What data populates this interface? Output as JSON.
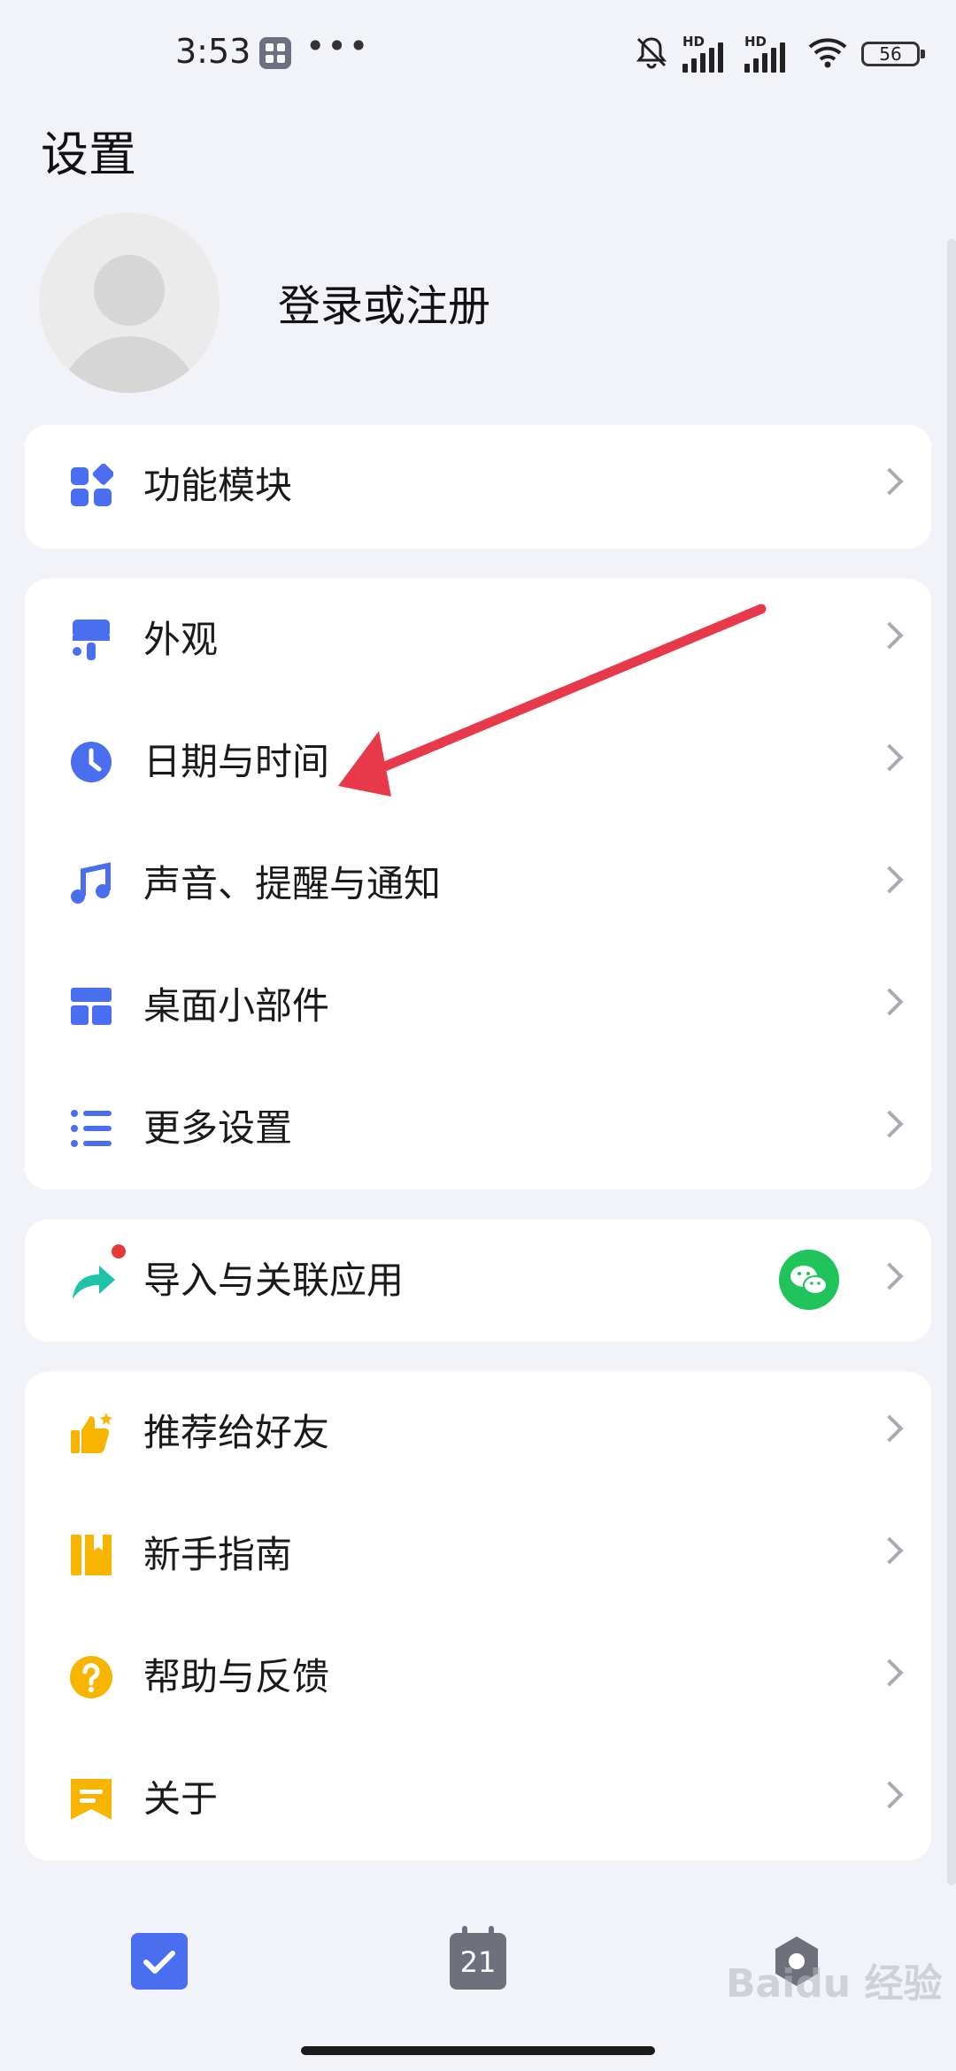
{
  "status_bar": {
    "time": "3:53",
    "dots": "•••",
    "signal_label": "HD",
    "battery": "56"
  },
  "page": {
    "title": "设置"
  },
  "profile": {
    "login_label": "登录或注册"
  },
  "groups": [
    {
      "items": [
        {
          "label": "功能模块",
          "icon": "grid-modules-icon"
        }
      ]
    },
    {
      "items": [
        {
          "label": "外观",
          "icon": "paint-roller-icon"
        },
        {
          "label": "日期与时间",
          "icon": "clock-icon"
        },
        {
          "label": "声音、提醒与通知",
          "icon": "music-note-icon"
        },
        {
          "label": "桌面小部件",
          "icon": "widget-layout-icon"
        },
        {
          "label": "更多设置",
          "icon": "list-settings-icon"
        }
      ]
    },
    {
      "items": [
        {
          "label": "导入与关联应用",
          "icon": "share-arrow-icon",
          "badge": true,
          "trailing": "wechat-icon"
        }
      ]
    },
    {
      "items": [
        {
          "label": "推荐给好友",
          "icon": "thumbs-up-icon"
        },
        {
          "label": "新手指南",
          "icon": "guide-book-icon"
        },
        {
          "label": "帮助与反馈",
          "icon": "question-icon"
        },
        {
          "label": "关于",
          "icon": "about-bookmark-icon"
        }
      ]
    }
  ],
  "tabbar": {
    "calendar_day": "21"
  },
  "watermark": "Baidu 经验",
  "colors": {
    "accent_blue": "#4a6ef0",
    "accent_orange": "#f7b500",
    "accent_green": "#1fc45a",
    "annotation_red": "#e8394a"
  }
}
